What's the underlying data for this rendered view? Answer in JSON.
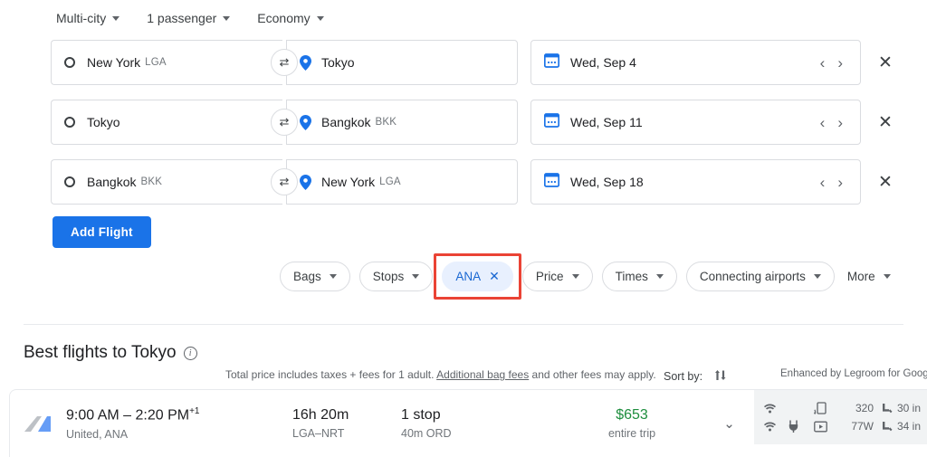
{
  "option_bar": [
    {
      "label": "Multi-city",
      "icon": "chevron-down-icon"
    },
    {
      "label": "1 passenger",
      "icon": "chevron-down-icon"
    },
    {
      "label": "Economy",
      "icon": "chevron-down-icon"
    }
  ],
  "flight_rows": [
    {
      "origin": {
        "city": "New York",
        "code": "LGA"
      },
      "destination": {
        "city": "Tokyo",
        "code": ""
      },
      "date": "Wed, Sep 4"
    },
    {
      "origin": {
        "city": "Tokyo",
        "code": ""
      },
      "destination": {
        "city": "Bangkok",
        "code": "BKK"
      },
      "date": "Wed, Sep 11"
    },
    {
      "origin": {
        "city": "Bangkok",
        "code": "BKK"
      },
      "destination": {
        "city": "New York",
        "code": "LGA"
      },
      "date": "Wed, Sep 18"
    }
  ],
  "add_flight_label": "Add Flight",
  "filters": [
    {
      "label": "Bags",
      "type": "dropdown",
      "active": false
    },
    {
      "label": "Stops",
      "type": "dropdown",
      "active": false
    },
    {
      "label": "ANA",
      "type": "removable",
      "active": true,
      "highlighted": true
    },
    {
      "label": "Price",
      "type": "dropdown",
      "active": false
    },
    {
      "label": "Times",
      "type": "dropdown",
      "active": false
    },
    {
      "label": "Connecting airports",
      "type": "dropdown",
      "active": false
    },
    {
      "label": "More",
      "type": "plain",
      "active": false
    }
  ],
  "results": {
    "heading": "Best flights to Tokyo",
    "disclaimer_pre": "Total price includes taxes + fees for 1 adult. ",
    "disclaimer_link": "Additional bag fees",
    "disclaimer_post": " and other fees may apply.",
    "sort_by_label": "Sort by:",
    "legroom_note": "Enhanced by Legroom for Google F",
    "flights": [
      {
        "times": "9:00 AM – 2:20 PM",
        "day_offset": "+1",
        "airlines": "United, ANA",
        "duration": "16h 20m",
        "route": "LGA–NRT",
        "stops": "1 stop",
        "layover": "40m ORD",
        "price": "$653",
        "price_note": "entire trip",
        "amenities": {
          "row1": {
            "wifi": true,
            "power": false,
            "video": false,
            "stream": true,
            "value": "320",
            "legroom": "30 in"
          },
          "row2": {
            "wifi": true,
            "power": true,
            "video": true,
            "stream": false,
            "value": "77W",
            "legroom": "34 in"
          }
        }
      }
    ]
  },
  "colors": {
    "accent_blue": "#1a73e8",
    "chip_active_bg": "#e8f0fe",
    "chip_active_text": "#1967d2",
    "highlight_red": "#ea4335",
    "price_green": "#1e8e3e"
  }
}
